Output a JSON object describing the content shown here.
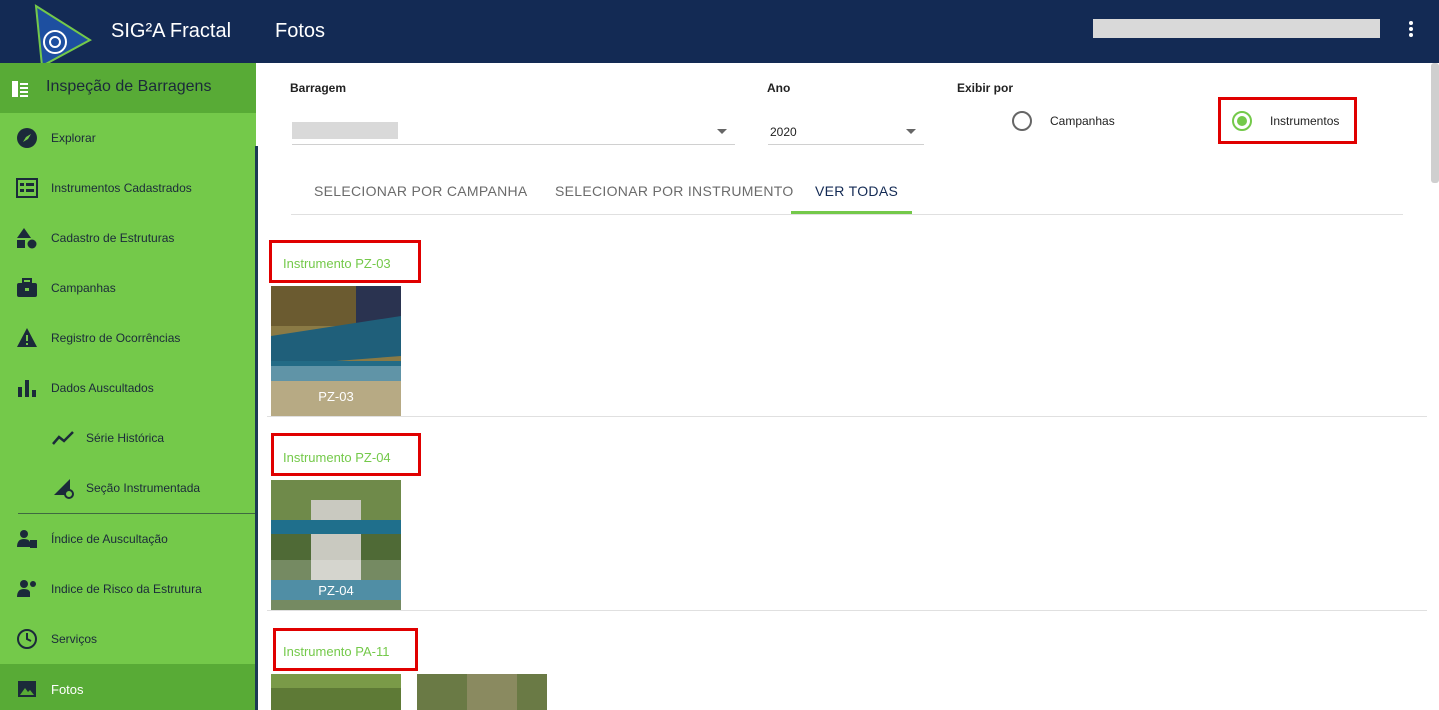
{
  "header": {
    "app_title": "SIG²A Fractal",
    "page_title": "Fotos"
  },
  "sidebar": {
    "section_title": "Inspeção de Barragens",
    "items": [
      {
        "label": "Explorar",
        "icon": "compass-icon"
      },
      {
        "label": "Instrumentos Cadastrados",
        "icon": "grid-list-icon"
      },
      {
        "label": "Cadastro de Estruturas",
        "icon": "shapes-icon"
      },
      {
        "label": "Campanhas",
        "icon": "briefcase-icon"
      },
      {
        "label": "Registro de Ocorrências",
        "icon": "warning-icon"
      },
      {
        "label": "Dados Auscultados",
        "icon": "bar-chart-icon"
      },
      {
        "label": "Série Histórica",
        "icon": "trend-line-icon"
      },
      {
        "label": "Seção Instrumentada",
        "icon": "section-gear-icon"
      },
      {
        "label": "Índice de Auscultação",
        "icon": "person-badge-icon"
      },
      {
        "label": "Indice de Risco da Estrutura",
        "icon": "person-gear-icon"
      },
      {
        "label": "Serviços",
        "icon": "clock-icon"
      },
      {
        "label": "Fotos",
        "icon": "image-icon"
      }
    ],
    "active": "Fotos"
  },
  "filters": {
    "barragem_label": "Barragem",
    "ano_label": "Ano",
    "ano_value": "2020",
    "exibir_label": "Exibir por",
    "radio_campanhas": "Campanhas",
    "radio_instrumentos": "Instrumentos",
    "selected": "Instrumentos"
  },
  "tabs": [
    {
      "label": "SELECIONAR POR CAMPANHA"
    },
    {
      "label": "SELECIONAR POR INSTRUMENTO"
    },
    {
      "label": "VER TODAS"
    }
  ],
  "active_tab": "VER TODAS",
  "sections": [
    {
      "title": "Instrumento PZ-03",
      "photos": [
        "PZ-03"
      ]
    },
    {
      "title": "Instrumento PZ-04",
      "photos": [
        "PZ-04"
      ]
    },
    {
      "title": "Instrumento PA-11",
      "photos": [
        "",
        ""
      ]
    }
  ],
  "colors": {
    "topbar": "#132a54",
    "sidebar": "#74c94a",
    "sidebar_active": "#58ab36",
    "accent": "#74c94a",
    "highlight_box": "#e00000"
  }
}
